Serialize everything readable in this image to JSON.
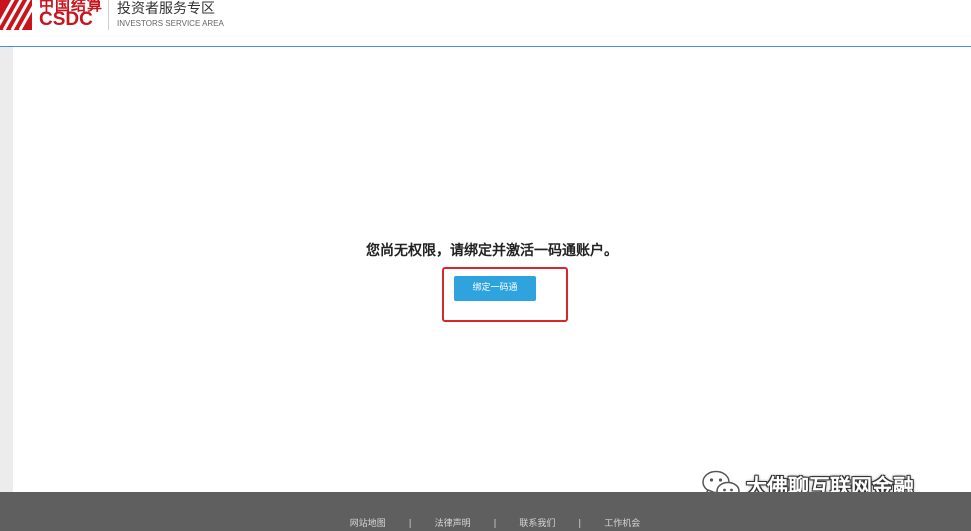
{
  "header": {
    "logo_cn": "中国结算",
    "logo_en": "CSDC",
    "area_title": "投资者服务专区",
    "area_subtitle": "INVESTORS SERVICE AREA"
  },
  "main": {
    "message": "您尚无权限，请绑定并激活一码通账户。",
    "bind_button_label": "绑定一码通"
  },
  "watermark": {
    "text": "大佛聊互联网金融",
    "icon": "wechat-icon"
  },
  "footer": {
    "links": [
      "网站地图",
      "法律声明",
      "联系我们",
      "工作机会"
    ],
    "separator": "|"
  },
  "colors": {
    "brand_red": "#c8151d",
    "button_blue": "#2ea3de",
    "highlight_red": "#d9262c",
    "footer_gray": "#5f5f5f",
    "header_rule": "#4a90d9"
  }
}
